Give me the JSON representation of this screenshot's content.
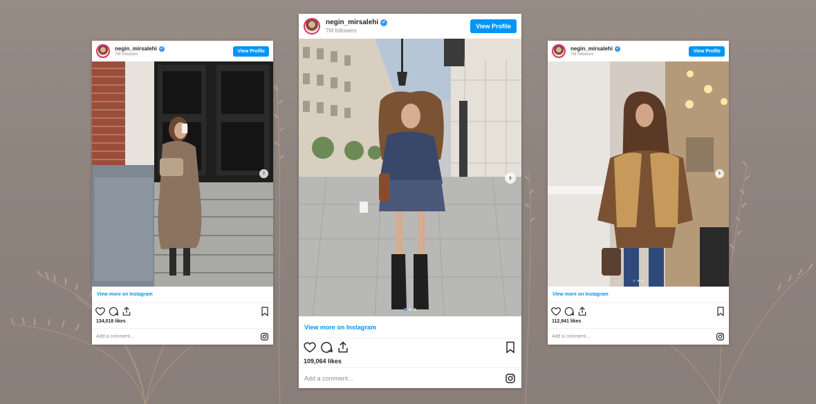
{
  "posts": [
    {
      "username": "negin_mirsalehi",
      "followers": "7M followers",
      "view_profile": "View Profile",
      "view_more": "View more on Instagram",
      "likes": "134,018 likes",
      "comment_placeholder": "Add a comment...",
      "verified_glyph": "✓",
      "next_glyph": "›"
    },
    {
      "username": "negin_mirsalehi",
      "followers": "7M followers",
      "view_profile": "View Profile",
      "view_more": "View more on Instagram",
      "likes": "109,064 likes",
      "comment_placeholder": "Add a comment...",
      "verified_glyph": "✓",
      "next_glyph": "›"
    },
    {
      "username": "negin_mirsalehi",
      "followers": "7M followers",
      "view_profile": "View Profile",
      "view_more": "View more on Instagram",
      "likes": "112,941 likes",
      "comment_placeholder": "Add a comment...",
      "verified_glyph": "✓",
      "next_glyph": "›"
    }
  ],
  "icons": {
    "like": "heart-icon",
    "comment": "comment-icon",
    "share": "share-icon",
    "save": "bookmark-icon",
    "instagram": "instagram-logo-icon"
  },
  "colors": {
    "background": "#8f837e",
    "button": "#0095f6",
    "link": "#0095f6",
    "verified": "#3897f0"
  }
}
